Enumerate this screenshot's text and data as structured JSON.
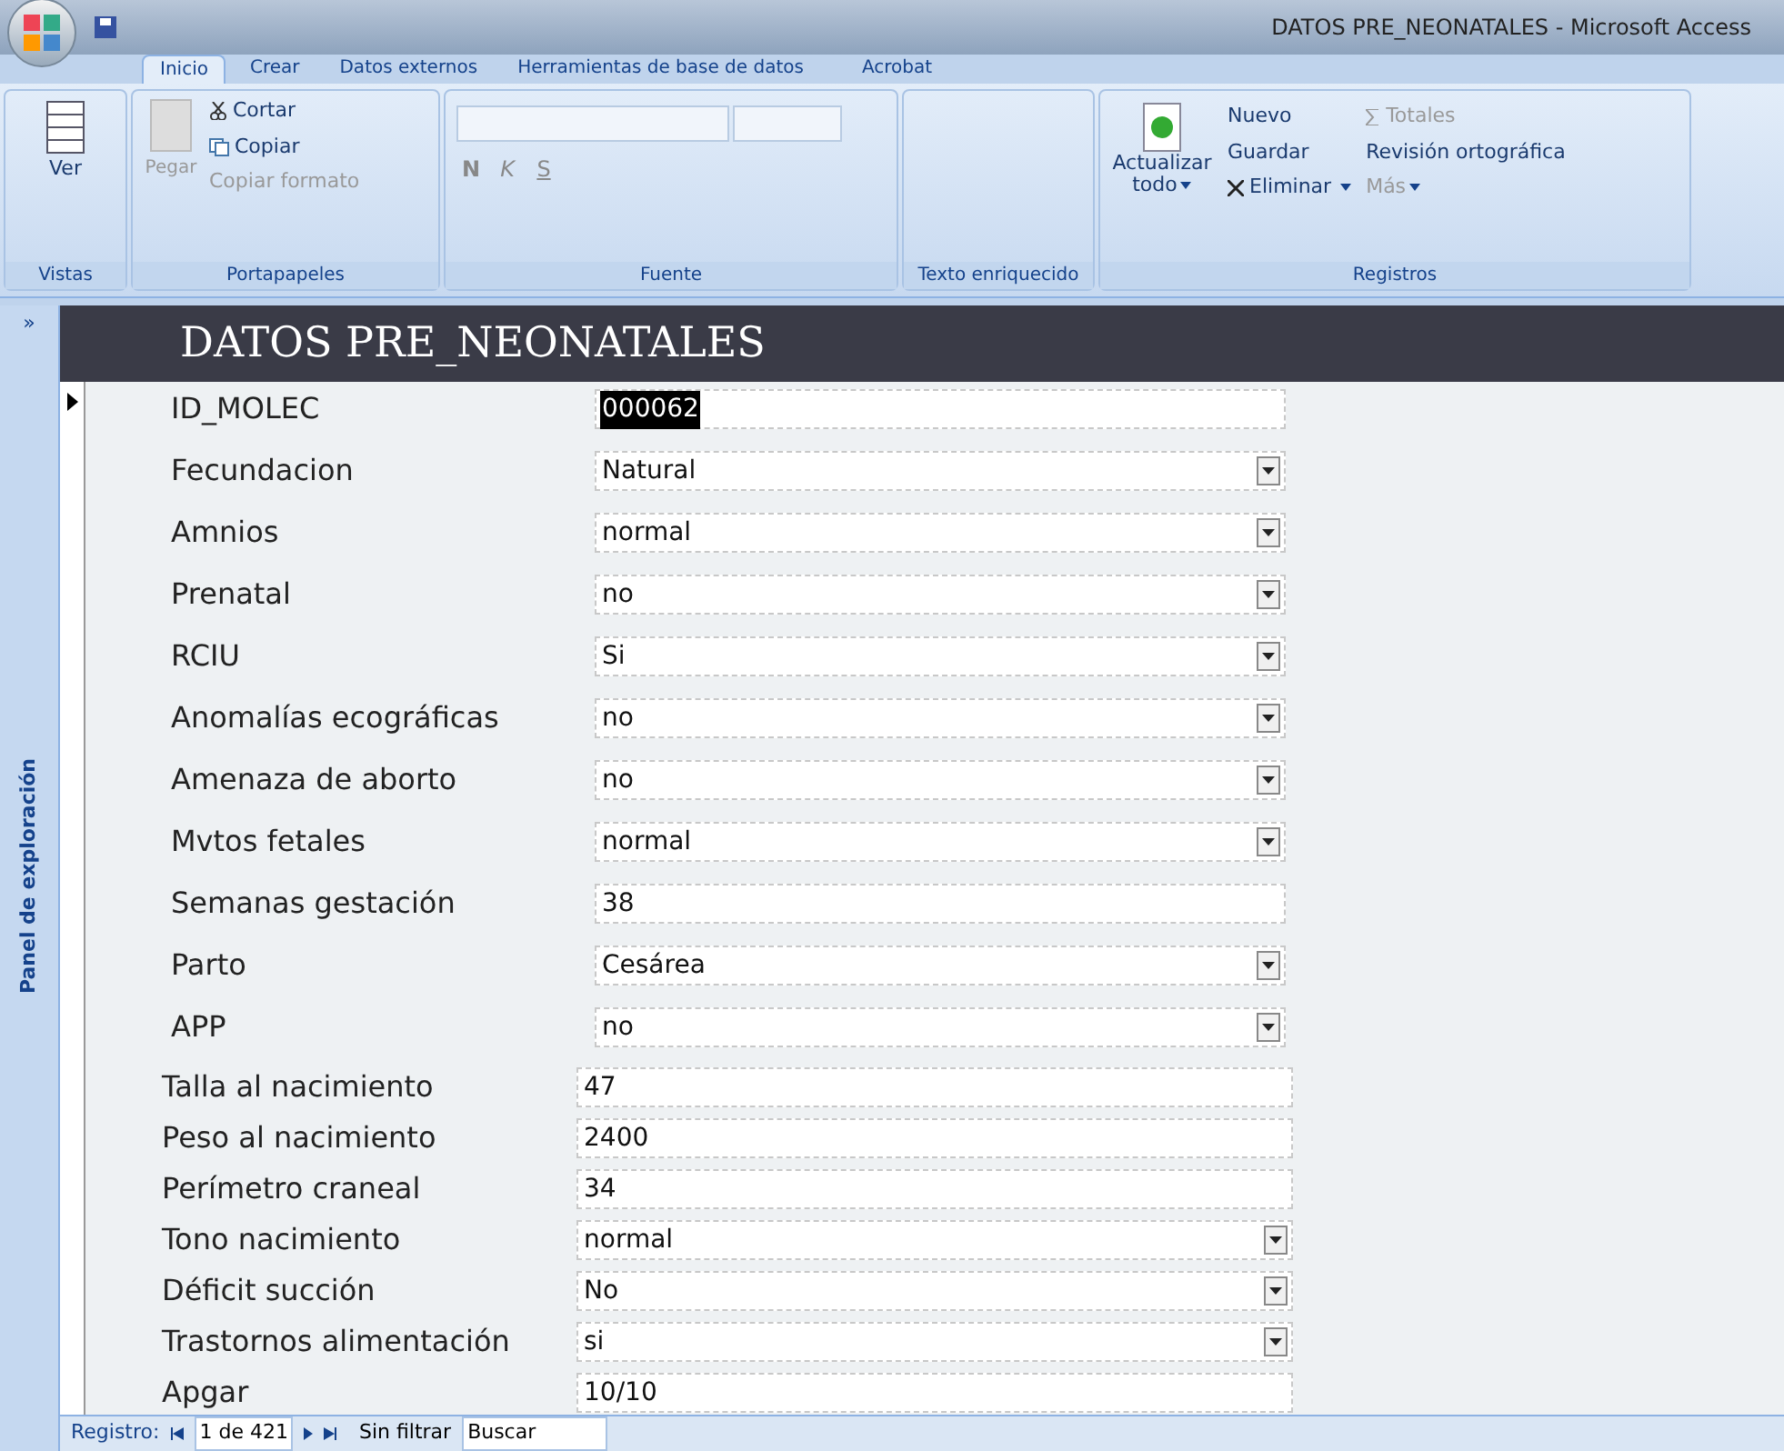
{
  "window": {
    "title": "DATOS PRE_NEONATALES - Microsoft Access"
  },
  "tabs": [
    {
      "label": "Inicio",
      "selected": true
    },
    {
      "label": "Crear",
      "selected": false
    },
    {
      "label": "Datos externos",
      "selected": false
    },
    {
      "label": "Herramientas de base de datos",
      "selected": false
    },
    {
      "label": "Acrobat",
      "selected": false
    }
  ],
  "ribbon": {
    "vistas": {
      "ver": "Ver",
      "group": "Vistas"
    },
    "portapapeles": {
      "pegar": "Pegar",
      "cortar": "Cortar",
      "copiar": "Copiar",
      "copiar_formato": "Copiar formato",
      "group": "Portapapeles"
    },
    "fuente": {
      "bold": "N",
      "italic": "K",
      "underline": "S",
      "group": "Fuente"
    },
    "texto": {
      "group": "Texto enriquecido"
    },
    "registros": {
      "actualizar": "Actualizar todo",
      "nuevo": "Nuevo",
      "guardar": "Guardar",
      "eliminar": "Eliminar",
      "totales": "Totales",
      "revision": "Revisión ortográfica",
      "mas": "Más",
      "group": "Registros"
    }
  },
  "nav_pane": {
    "label": "Panel de exploración",
    "toggle": "»"
  },
  "form": {
    "title": "DATOS PRE_NEONATALES",
    "groups": [
      [
        {
          "label": "ID_MOLEC",
          "value": "000062",
          "kind": "text",
          "highlighted": true
        },
        {
          "label": "Fecundacion",
          "value": "Natural",
          "kind": "combo",
          "highlighted": false
        },
        {
          "label": "Amnios",
          "value": "normal",
          "kind": "combo",
          "highlighted": false
        },
        {
          "label": "Prenatal",
          "value": "no",
          "kind": "combo",
          "highlighted": false
        },
        {
          "label": "RCIU",
          "value": "Si",
          "kind": "combo",
          "highlighted": false
        },
        {
          "label": "Anomalías ecográficas",
          "value": "no",
          "kind": "combo",
          "highlighted": false
        },
        {
          "label": "Amenaza de aborto",
          "value": "no",
          "kind": "combo",
          "highlighted": false
        },
        {
          "label": "Mvtos fetales",
          "value": "normal",
          "kind": "combo",
          "highlighted": false
        },
        {
          "label": "Semanas gestación",
          "value": "38",
          "kind": "text",
          "highlighted": false
        },
        {
          "label": "Parto",
          "value": "Cesárea",
          "kind": "combo",
          "highlighted": false
        },
        {
          "label": "APP",
          "value": "no",
          "kind": "combo",
          "highlighted": false
        }
      ],
      [
        {
          "label": "Talla al nacimiento",
          "value": "47",
          "kind": "text",
          "highlighted": false
        },
        {
          "label": "Peso al nacimiento",
          "value": "2400",
          "kind": "text",
          "highlighted": false
        },
        {
          "label": "Perímetro craneal",
          "value": "34",
          "kind": "text",
          "highlighted": false
        },
        {
          "label": "Tono nacimiento",
          "value": "normal",
          "kind": "combo",
          "highlighted": false
        },
        {
          "label": "Déficit succión",
          "value": "No",
          "kind": "combo",
          "highlighted": false
        },
        {
          "label": "Trastornos alimentación",
          "value": "si",
          "kind": "combo",
          "highlighted": false
        },
        {
          "label": "Apgar",
          "value": "10/10",
          "kind": "text",
          "highlighted": false
        }
      ]
    ]
  },
  "record_nav": {
    "label": "Registro:",
    "position": "1 de 421",
    "filter": "Sin filtrar",
    "search": "Buscar"
  }
}
